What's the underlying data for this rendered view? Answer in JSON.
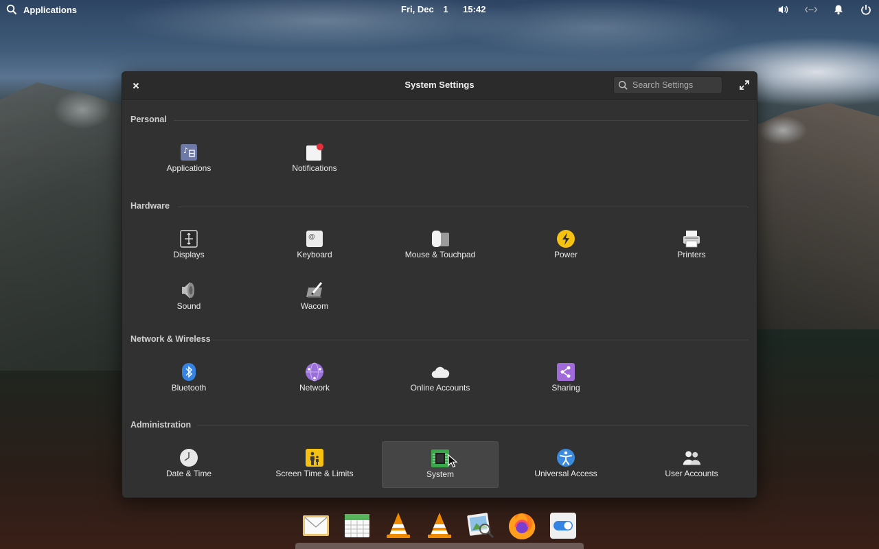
{
  "topbar": {
    "applications_label": "Applications",
    "date": "Fri, Dec",
    "day": "1",
    "time": "15:42"
  },
  "window": {
    "title": "System Settings",
    "search_placeholder": "Search Settings"
  },
  "sections": {
    "personal": {
      "title": "Personal",
      "items": [
        {
          "label": "Applications",
          "icon": "applications-icon"
        },
        {
          "label": "Notifications",
          "icon": "notifications-icon"
        }
      ]
    },
    "hardware": {
      "title": "Hardware",
      "items": [
        {
          "label": "Displays",
          "icon": "displays-icon"
        },
        {
          "label": "Keyboard",
          "icon": "keyboard-icon"
        },
        {
          "label": "Mouse & Touchpad",
          "icon": "mouse-touchpad-icon"
        },
        {
          "label": "Power",
          "icon": "power-icon"
        },
        {
          "label": "Printers",
          "icon": "printer-icon"
        },
        {
          "label": "Sound",
          "icon": "sound-icon"
        },
        {
          "label": "Wacom",
          "icon": "wacom-icon"
        }
      ]
    },
    "network": {
      "title": "Network & Wireless",
      "items": [
        {
          "label": "Bluetooth",
          "icon": "bluetooth-icon"
        },
        {
          "label": "Network",
          "icon": "network-icon"
        },
        {
          "label": "Online Accounts",
          "icon": "cloud-icon"
        },
        {
          "label": "Sharing",
          "icon": "share-icon"
        }
      ]
    },
    "administration": {
      "title": "Administration",
      "items": [
        {
          "label": "Date & Time",
          "icon": "clock-icon"
        },
        {
          "label": "Screen Time & Limits",
          "icon": "parental-icon"
        },
        {
          "label": "System",
          "icon": "chip-icon",
          "selected": true
        },
        {
          "label": "Universal Access",
          "icon": "accessibility-icon"
        },
        {
          "label": "User Accounts",
          "icon": "users-icon"
        }
      ]
    }
  },
  "dock": [
    "mail-icon",
    "calendar-icon",
    "vlc-icon",
    "vlc-icon",
    "image-viewer-icon",
    "firefox-icon",
    "settings-toggle-icon"
  ],
  "colors": {
    "window_bg": "#313131",
    "header_bg": "#2b2b2b",
    "selected_bg": "#454545",
    "notification_red": "#e5303b",
    "power_yellow": "#f5c211",
    "bluetooth_blue": "#3584e4",
    "network_purple": "#9b6fd9",
    "sharing_purple": "#a06bd8",
    "access_blue": "#3a8be0"
  }
}
